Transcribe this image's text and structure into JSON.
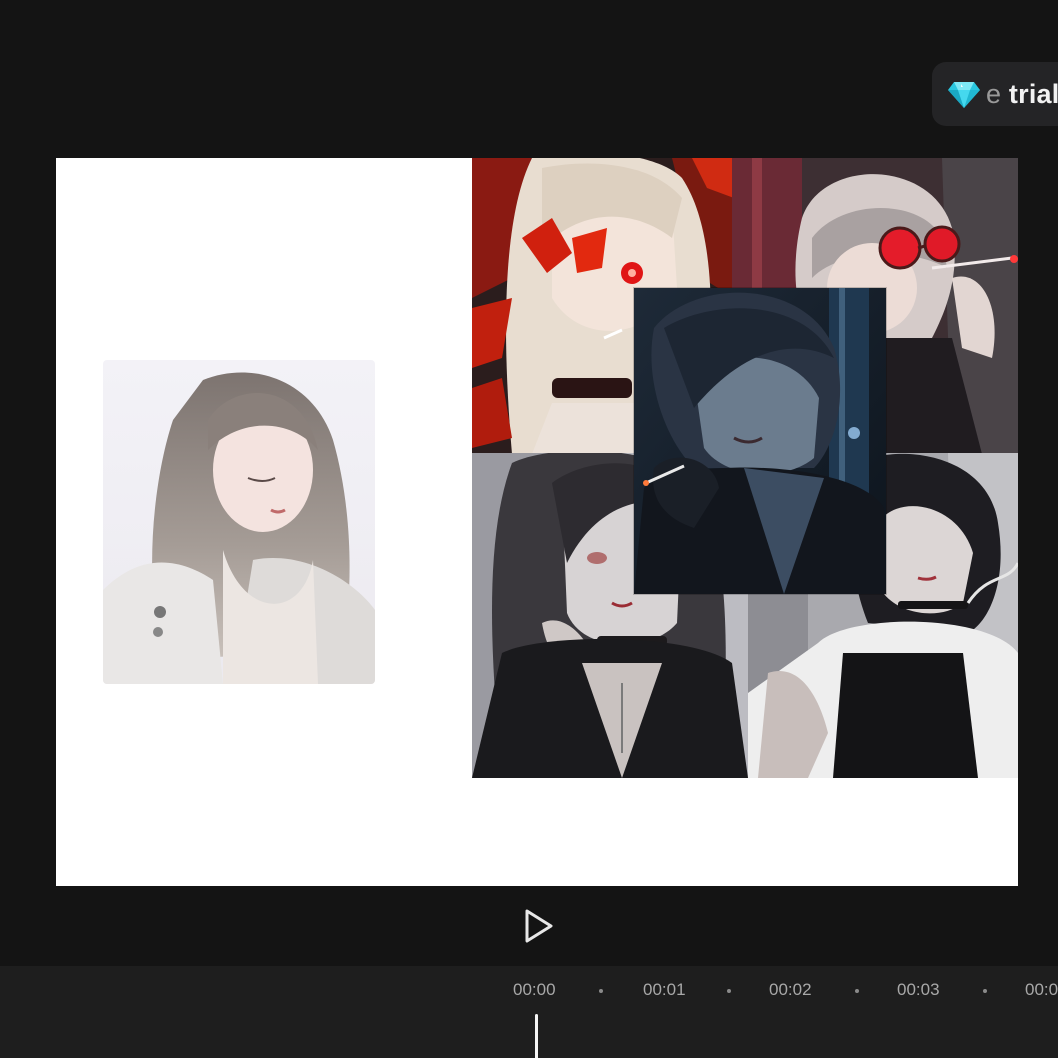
{
  "header": {
    "trial_button": {
      "label_faded": "e",
      "label": "trial",
      "icon": "diamond-icon",
      "icon_color": "#2fd1e6"
    }
  },
  "canvas": {
    "background": "#ffffff",
    "logo_icon": "capcut-logo-icon",
    "images": [
      {
        "name": "portrait-girl-white-jacket"
      },
      {
        "name": "portrait-red-butterflies"
      },
      {
        "name": "portrait-red-glasses"
      },
      {
        "name": "portrait-monochrome-left"
      },
      {
        "name": "portrait-monochrome-right"
      },
      {
        "name": "portrait-blue-smoking"
      }
    ]
  },
  "player": {
    "play_icon": "play-icon"
  },
  "timeline": {
    "ticks": [
      "00:00",
      "00:01",
      "00:02",
      "00:03",
      "00:0"
    ],
    "playhead_color": "#f5f5f5"
  }
}
